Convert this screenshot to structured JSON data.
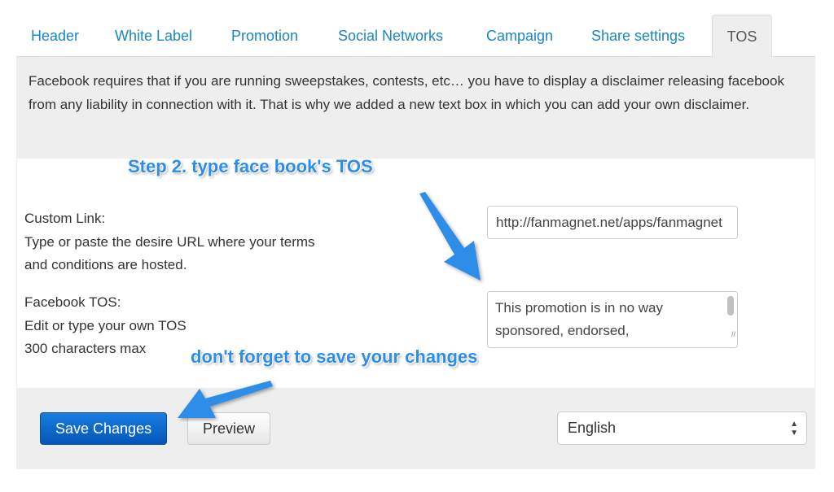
{
  "tabs": [
    {
      "label": "Header"
    },
    {
      "label": "White Label"
    },
    {
      "label": "Promotion"
    },
    {
      "label": "Social Networks"
    },
    {
      "label": "Campaign"
    },
    {
      "label": "Share settings"
    },
    {
      "label": "TOS",
      "active": true
    }
  ],
  "intro": "Facebook requires that if you are running sweepstakes, contests, etc… you have to display a disclaimer releasing facebook from any liability in connection with it. That is why we added a new text box in which you can add your own disclaimer.",
  "custom_link": {
    "title": "Custom Link:",
    "desc1": "Type or paste the desire URL where your terms",
    "desc2": "and conditions are hosted.",
    "value": "http://fanmagnet.net/apps/fanmagnet"
  },
  "facebook_tos": {
    "title": "Facebook TOS:",
    "desc1": "Edit or type your own TOS",
    "desc2": "300 characters max",
    "value": "This promotion is in no way sponsored, endorsed,"
  },
  "annotations": {
    "step2": "Step 2. type face book's TOS",
    "save_note": "don't forget to save your changes",
    "color": "#2f8de8"
  },
  "footer": {
    "save_label": "Save Changes",
    "preview_label": "Preview",
    "language": "English"
  }
}
